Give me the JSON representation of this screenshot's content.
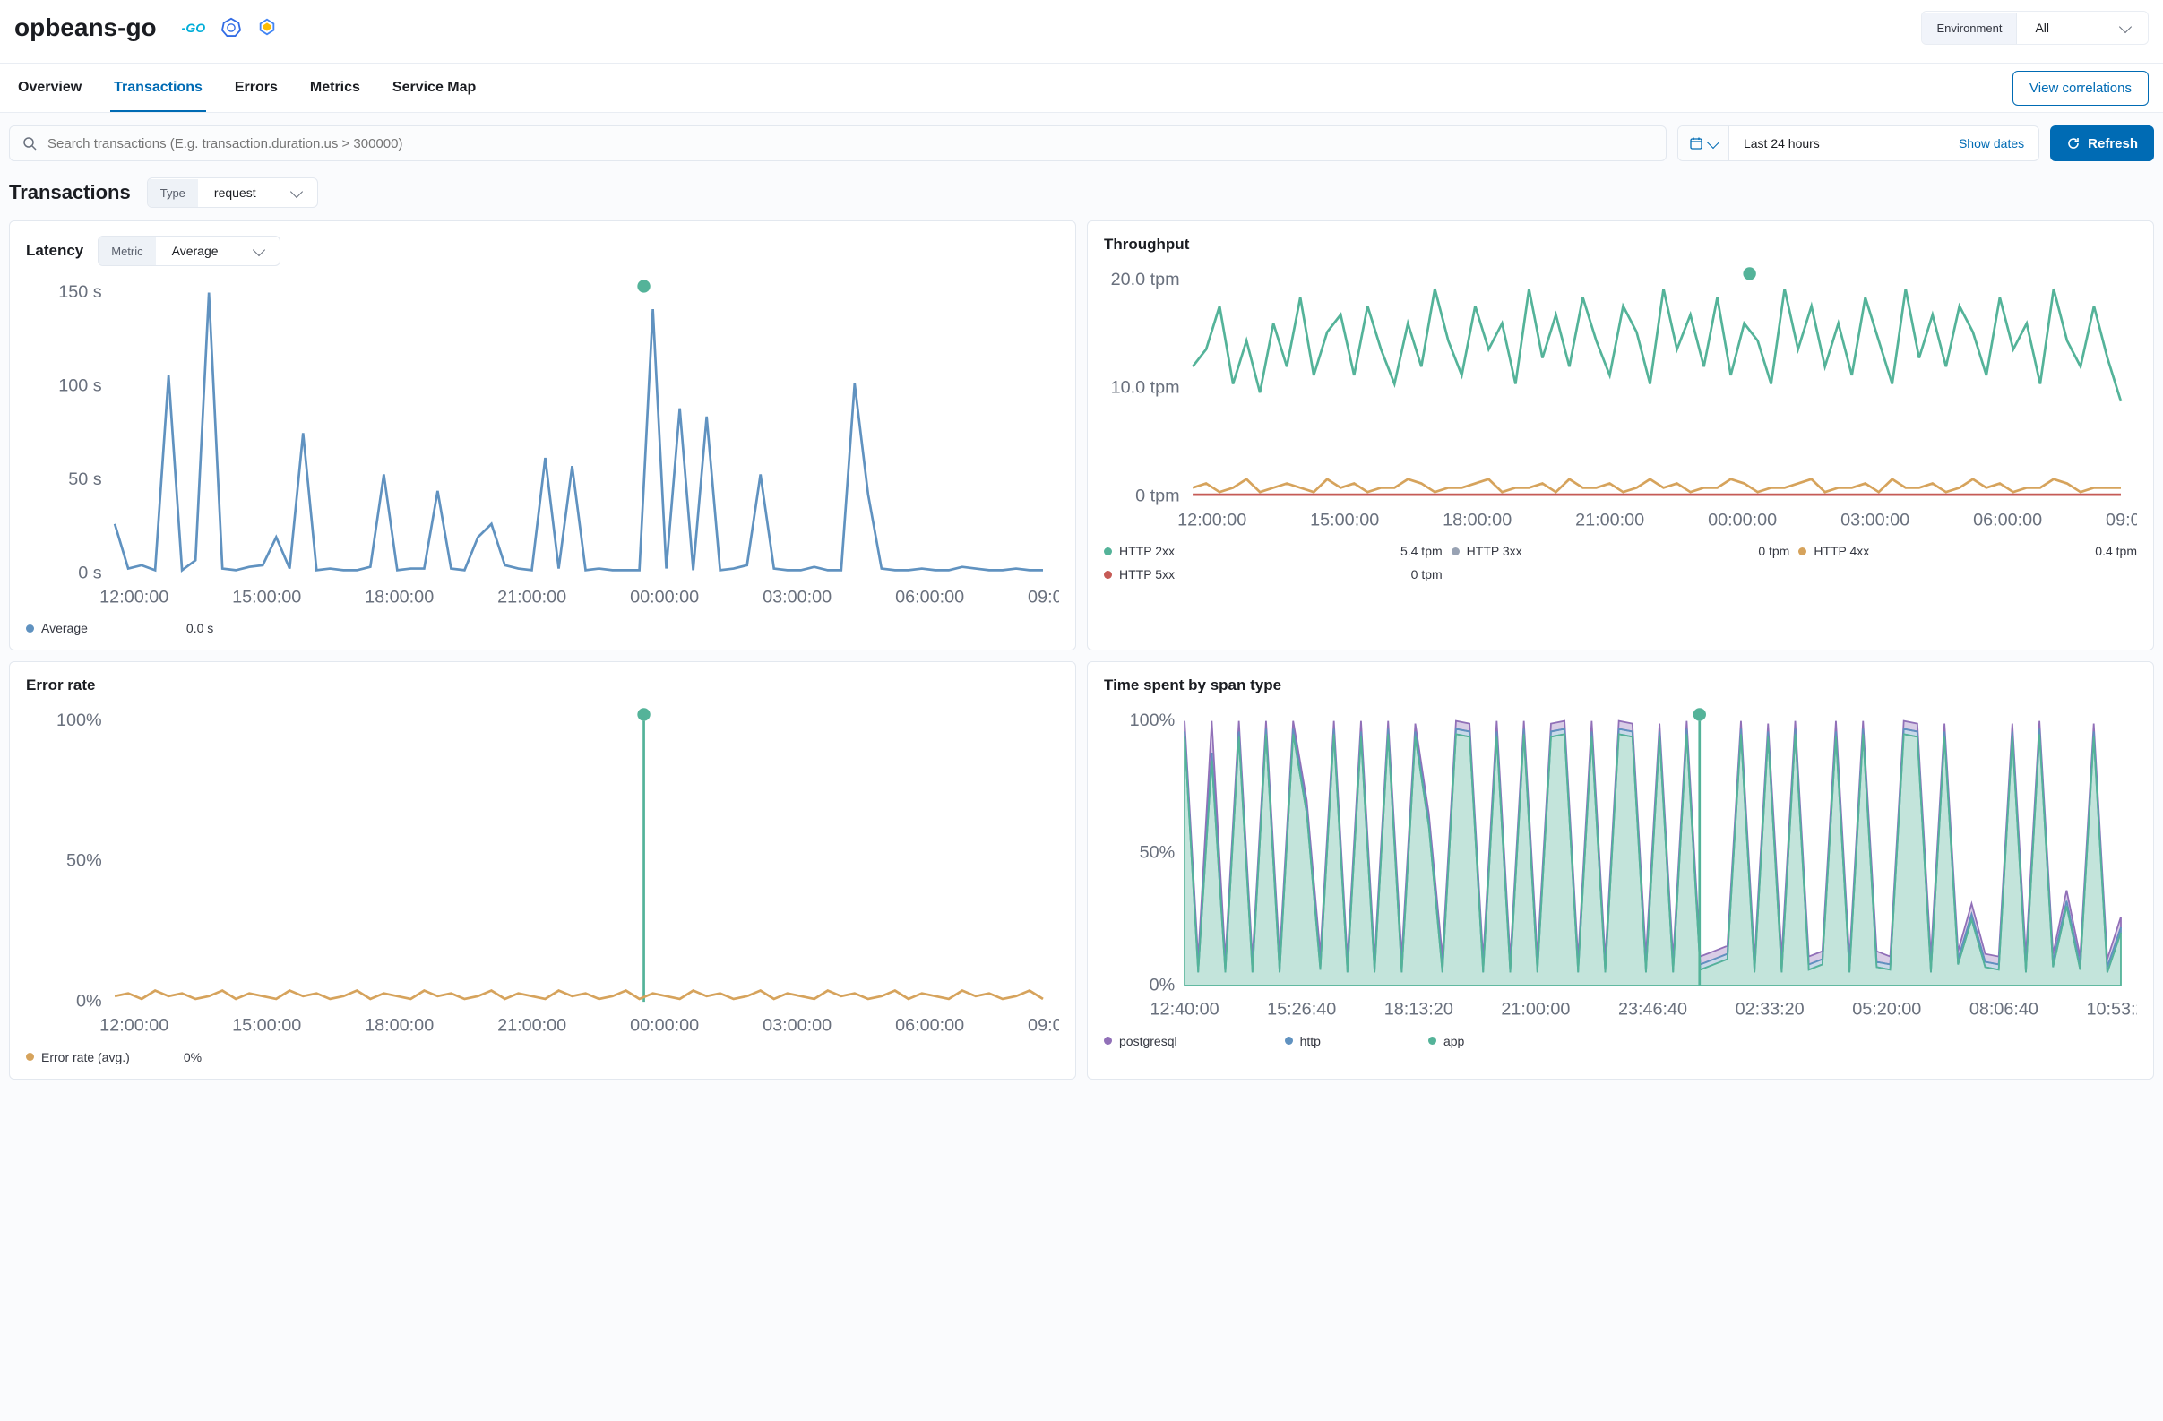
{
  "header": {
    "title": "opbeans-go",
    "env_label": "Environment",
    "env_value": "All"
  },
  "tabs": {
    "overview": "Overview",
    "transactions": "Transactions",
    "errors": "Errors",
    "metrics": "Metrics",
    "service_map": "Service Map",
    "active": "transactions",
    "view_correlations": "View correlations"
  },
  "filters": {
    "search_placeholder": "Search transactions (E.g. transaction.duration.us > 300000)",
    "date_range": "Last 24 hours",
    "show_dates": "Show dates",
    "refresh": "Refresh"
  },
  "section": {
    "title": "Transactions",
    "type_label": "Type",
    "type_value": "request"
  },
  "latency_panel": {
    "title": "Latency",
    "metric_label": "Metric",
    "metric_value": "Average",
    "legend_label": "Average",
    "legend_value": "0.0 s"
  },
  "throughput_panel": {
    "title": "Throughput",
    "legend": {
      "http2xx_label": "HTTP 2xx",
      "http2xx_value": "5.4 tpm",
      "http3xx_label": "HTTP 3xx",
      "http3xx_value": "0 tpm",
      "http4xx_label": "HTTP 4xx",
      "http4xx_value": "0.4 tpm",
      "http5xx_label": "HTTP 5xx",
      "http5xx_value": "0 tpm"
    }
  },
  "error_panel": {
    "title": "Error rate",
    "legend_label": "Error rate (avg.)",
    "legend_value": "0%"
  },
  "span_panel": {
    "title": "Time spent by span type",
    "legend": {
      "postgresql": "postgresql",
      "http": "http",
      "app": "app"
    }
  },
  "colors": {
    "blue_line": "#6092c0",
    "green": "#54b399",
    "orange": "#d6a35c",
    "red": "#c65b56",
    "gray": "#98a2b3",
    "purple": "#9170b8",
    "http_blue": "#6092c0",
    "app_green": "#54b399"
  },
  "chart_data": [
    {
      "id": "latency",
      "type": "line",
      "title": "Latency",
      "xlabel": "",
      "ylabel": "",
      "x_ticks": [
        "12:00:00",
        "15:00:00",
        "18:00:00",
        "21:00:00",
        "00:00:00",
        "03:00:00",
        "06:00:00",
        "09:00:00"
      ],
      "y_ticks": [
        "0 s",
        "50 s",
        "100 s",
        "150 s"
      ],
      "ylim": [
        0,
        170
      ],
      "series": [
        {
          "name": "Average",
          "color": "#6092c0",
          "values": [
            30,
            3,
            5,
            2,
            120,
            2,
            8,
            170,
            3,
            2,
            4,
            5,
            22,
            3,
            85,
            2,
            3,
            2,
            2,
            4,
            60,
            2,
            3,
            3,
            50,
            3,
            2,
            22,
            30,
            5,
            3,
            2,
            70,
            3,
            65,
            2,
            3,
            2,
            2,
            2,
            160,
            3,
            100,
            2,
            95,
            2,
            3,
            5,
            60,
            3,
            2,
            2,
            4,
            2,
            2,
            115,
            48,
            3,
            2,
            2,
            3,
            2,
            2,
            4,
            3,
            2,
            2,
            3,
            2,
            2
          ]
        }
      ],
      "marker_x": 0.57
    },
    {
      "id": "throughput",
      "type": "line",
      "title": "Throughput",
      "x_ticks": [
        "12:00:00",
        "15:00:00",
        "18:00:00",
        "21:00:00",
        "00:00:00",
        "03:00:00",
        "06:00:00",
        "09:00:00"
      ],
      "y_ticks": [
        "0 tpm",
        "10.0 tpm",
        "20.0 tpm"
      ],
      "ylim": [
        0,
        25
      ],
      "series": [
        {
          "name": "HTTP 2xx",
          "color": "#54b399",
          "values": [
            15,
            17,
            22,
            13,
            18,
            12,
            20,
            15,
            23,
            14,
            19,
            21,
            14,
            22,
            17,
            13,
            20,
            15,
            24,
            18,
            14,
            22,
            17,
            20,
            13,
            24,
            16,
            21,
            15,
            23,
            18,
            14,
            22,
            19,
            13,
            24,
            17,
            21,
            15,
            23,
            14,
            20,
            18,
            13,
            24,
            17,
            22,
            15,
            20,
            14,
            23,
            18,
            13,
            24,
            16,
            21,
            15,
            22,
            19,
            14,
            23,
            17,
            20,
            13,
            24,
            18,
            15,
            22,
            16,
            11
          ]
        },
        {
          "name": "HTTP 4xx",
          "color": "#d6a35c",
          "values": [
            1,
            1.5,
            0.5,
            1,
            2,
            0.5,
            1,
            1.5,
            1,
            0.5,
            2,
            1,
            1.5,
            0.5,
            1,
            1,
            2,
            1.5,
            0.5,
            1,
            1,
            1.5,
            2,
            0.5,
            1,
            1,
            1.5,
            0.5,
            2,
            1,
            1,
            1.5,
            0.5,
            1,
            2,
            1,
            1.5,
            0.5,
            1,
            1,
            2,
            1.5,
            0.5,
            1,
            1,
            1.5,
            2,
            0.5,
            1,
            1,
            1.5,
            0.5,
            2,
            1,
            1,
            1.5,
            0.5,
            1,
            2,
            1,
            1.5,
            0.5,
            1,
            1,
            2,
            1.5,
            0.5,
            1,
            1,
            1
          ]
        },
        {
          "name": "HTTP 5xx",
          "color": "#c65b56",
          "values": [
            0.2,
            0.2,
            0.2,
            0.2,
            0.2,
            0.2,
            0.2,
            0.2,
            0.2,
            0.2,
            0.2,
            0.2,
            0.2,
            0.2,
            0.2,
            0.2,
            0.2,
            0.2,
            0.2,
            0.2,
            0.2,
            0.2,
            0.2,
            0.2,
            0.2,
            0.2,
            0.2,
            0.2,
            0.2,
            0.2,
            0.2,
            0.2,
            0.2,
            0.2,
            0.2,
            0.2,
            0.2,
            0.2,
            0.2,
            0.2,
            0.2,
            0.2,
            0.2,
            0.2,
            0.2,
            0.2,
            0.2,
            0.2,
            0.2,
            0.2,
            0.2,
            0.2,
            0.2,
            0.2,
            0.2,
            0.2,
            0.2,
            0.2,
            0.2,
            0.2,
            0.2,
            0.2,
            0.2,
            0.2,
            0.2,
            0.2,
            0.2,
            0.2,
            0.2,
            0.2
          ]
        }
      ],
      "marker_x": 0.6
    },
    {
      "id": "error_rate",
      "type": "line",
      "title": "Error rate",
      "x_ticks": [
        "12:00:00",
        "15:00:00",
        "18:00:00",
        "21:00:00",
        "00:00:00",
        "03:00:00",
        "06:00:00",
        "09:00:00"
      ],
      "y_ticks": [
        "0%",
        "50%",
        "100%"
      ],
      "ylim": [
        0,
        100
      ],
      "series": [
        {
          "name": "Error rate (avg.)",
          "color": "#d6a35c",
          "values": [
            2,
            3,
            1,
            4,
            2,
            3,
            1,
            2,
            4,
            1,
            3,
            2,
            1,
            4,
            2,
            3,
            1,
            2,
            4,
            1,
            3,
            2,
            1,
            4,
            2,
            3,
            1,
            2,
            4,
            1,
            3,
            2,
            1,
            4,
            2,
            3,
            1,
            2,
            4,
            1,
            3,
            2,
            1,
            4,
            2,
            3,
            1,
            2,
            4,
            1,
            3,
            2,
            1,
            4,
            2,
            3,
            1,
            2,
            4,
            1,
            3,
            2,
            1,
            4,
            2,
            3,
            1,
            2,
            4,
            1
          ]
        }
      ],
      "verticals": [
        {
          "x": 0.57,
          "color": "#54b399"
        }
      ],
      "marker_x": 0.57
    },
    {
      "id": "span_type",
      "type": "area",
      "title": "Time spent by span type",
      "x_ticks": [
        "12:40:00",
        "15:26:40",
        "18:13:20",
        "21:00:00",
        "23:46:40",
        "02:33:20",
        "05:20:00",
        "08:06:40",
        "10:53:20"
      ],
      "y_ticks": [
        "0%",
        "50%",
        "100%"
      ],
      "ylim": [
        0,
        100
      ],
      "stack_order": [
        "app",
        "http",
        "postgresql"
      ],
      "series": [
        {
          "name": "postgresql",
          "color": "#9170b8",
          "values": [
            4,
            3,
            12,
            3,
            4,
            3,
            3,
            4,
            3,
            3,
            4,
            3,
            3,
            4,
            3,
            3,
            4,
            3,
            3,
            4,
            3,
            3,
            3,
            4,
            3,
            3,
            4,
            3,
            3,
            3,
            4,
            3,
            3,
            3,
            4,
            3,
            3,
            4,
            3,
            3,
            3,
            4,
            3,
            3,
            4,
            3,
            3,
            3,
            4,
            3,
            3,
            4,
            3,
            3,
            3,
            4,
            3,
            3,
            4,
            3,
            3,
            3,
            4,
            3,
            3,
            4,
            3,
            3,
            3,
            4
          ]
        },
        {
          "name": "http",
          "color": "#6092c0",
          "values": [
            2,
            2,
            3,
            2,
            2,
            2,
            2,
            2,
            2,
            2,
            2,
            2,
            2,
            2,
            2,
            2,
            2,
            2,
            2,
            2,
            2,
            2,
            2,
            2,
            2,
            2,
            2,
            2,
            2,
            2,
            2,
            2,
            2,
            2,
            2,
            2,
            2,
            2,
            2,
            2,
            2,
            2,
            2,
            2,
            2,
            2,
            2,
            2,
            2,
            2,
            2,
            2,
            2,
            2,
            2,
            2,
            2,
            2,
            2,
            2,
            2,
            2,
            2,
            2,
            2,
            2,
            2,
            2,
            2,
            2
          ]
        },
        {
          "name": "app",
          "color": "#54b399",
          "values": [
            94,
            5,
            85,
            5,
            94,
            5,
            95,
            5,
            95,
            65,
            6,
            95,
            5,
            94,
            5,
            95,
            5,
            94,
            60,
            5,
            95,
            94,
            5,
            94,
            5,
            95,
            5,
            94,
            95,
            5,
            94,
            5,
            95,
            94,
            5,
            94,
            5,
            95,
            6,
            8,
            10,
            95,
            5,
            94,
            5,
            95,
            6,
            8,
            94,
            5,
            95,
            7,
            6,
            95,
            94,
            5,
            94,
            8,
            25,
            7,
            6,
            94,
            5,
            95,
            7,
            30,
            6,
            94,
            5,
            20
          ]
        }
      ],
      "verticals": [
        {
          "x": 0.55,
          "color": "#54b399"
        }
      ],
      "marker_x": 0.55
    }
  ]
}
